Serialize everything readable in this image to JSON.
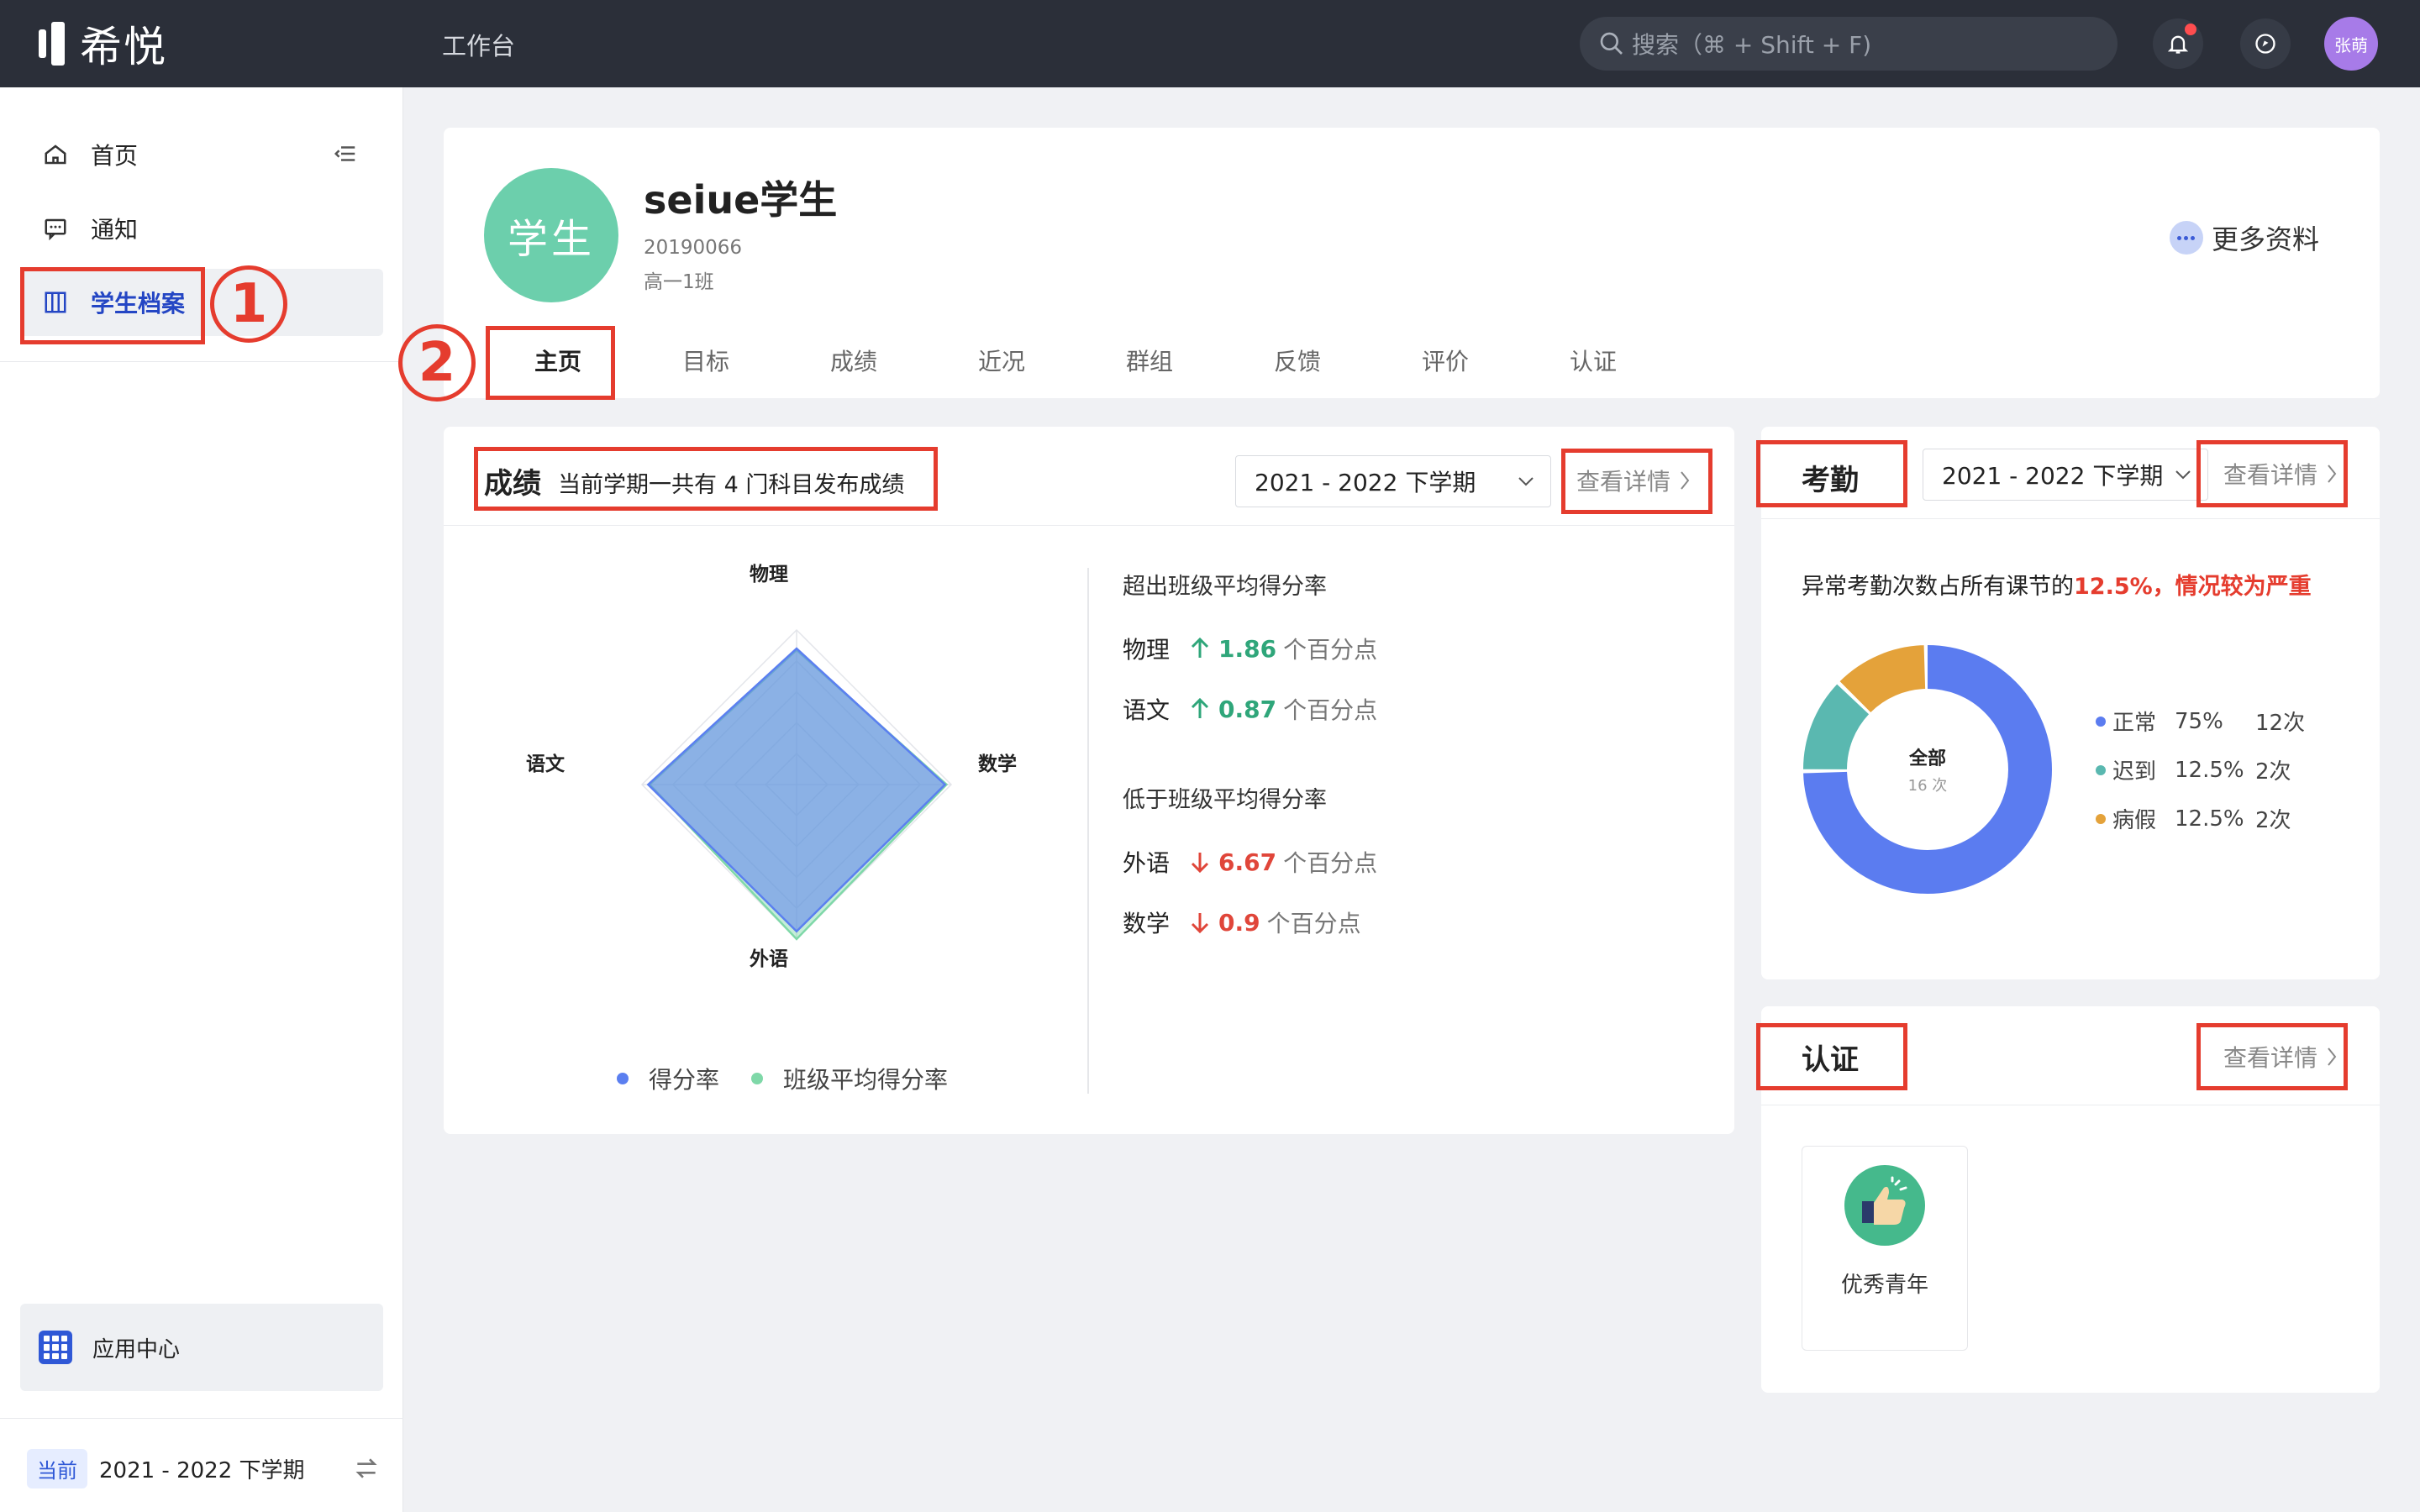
{
  "app": {
    "name": "希悦",
    "workbench": "工作台"
  },
  "search": {
    "placeholder": "搜索（⌘ + Shift + F)"
  },
  "user": {
    "avatar_text": "张萌"
  },
  "sidebar": {
    "items": [
      {
        "label": "首页",
        "icon": "home-icon"
      },
      {
        "label": "通知",
        "icon": "message-icon"
      },
      {
        "label": "学生档案",
        "icon": "archive-icon",
        "active": true
      }
    ],
    "app_center": "应用中心",
    "term_badge": "当前",
    "term": "2021 - 2022 下学期"
  },
  "profile": {
    "avatar_text": "学生",
    "name": "seiue学生",
    "student_id": "20190066",
    "class": "高一1班",
    "more": "更多资料",
    "tabs": [
      "主页",
      "目标",
      "成绩",
      "近况",
      "群组",
      "反馈",
      "评价",
      "认证"
    ],
    "active_tab": 0
  },
  "scores": {
    "title": "成绩",
    "subtitle": "当前学期一共有 4 门科目发布成绩",
    "term": "2021 - 2022 下学期",
    "detail": "查看详情",
    "above_head": "超出班级平均得分率",
    "above": [
      {
        "subject": "物理",
        "value": "1.86",
        "unit": "个百分点"
      },
      {
        "subject": "语文",
        "value": "0.87",
        "unit": "个百分点"
      }
    ],
    "below_head": "低于班级平均得分率",
    "below": [
      {
        "subject": "外语",
        "value": "6.67",
        "unit": "个百分点"
      },
      {
        "subject": "数学",
        "value": "0.9",
        "unit": "个百分点"
      }
    ],
    "legend": [
      "得分率",
      "班级平均得分率"
    ]
  },
  "attendance": {
    "title": "考勤",
    "term": "2021 - 2022 下学期",
    "detail": "查看详情",
    "note_prefix": "异常考勤次数占所有课节的",
    "note_highlight": "12.5%，情况较为严重",
    "center_label": "全部",
    "center_count": "16 次",
    "items": [
      {
        "name": "正常",
        "pct": "75%",
        "count": "12次",
        "color": "#5b7cf0"
      },
      {
        "name": "迟到",
        "pct": "12.5%",
        "count": "2次",
        "color": "#5ab8b0"
      },
      {
        "name": "病假",
        "pct": "12.5%",
        "count": "2次",
        "color": "#e4a23a"
      }
    ]
  },
  "certification": {
    "title": "认证",
    "detail": "查看详情",
    "badge": "优秀青年"
  },
  "annotations": {
    "one": "1",
    "two": "2"
  },
  "chart_data": {
    "type": "radar",
    "categories": [
      "物理",
      "数学",
      "外语",
      "语文"
    ],
    "series": [
      {
        "name": "得分率",
        "values": [
          0.88,
          0.96,
          0.95,
          0.96
        ],
        "color": "#5b7ff0"
      },
      {
        "name": "班级平均得分率",
        "values": [
          0.87,
          0.97,
          1.0,
          0.95
        ],
        "color": "#7fd8a8"
      }
    ],
    "ylim": [
      0,
      1
    ]
  }
}
